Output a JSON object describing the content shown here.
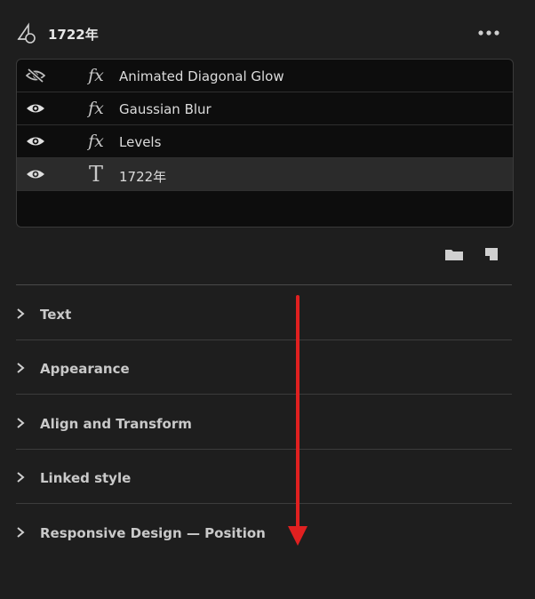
{
  "header": {
    "title": "1722年",
    "more_icon": "ellipsis-icon",
    "layer_icon": "shape-layer-icon"
  },
  "layers": [
    {
      "name": "Animated Diagonal Glow",
      "type_icon": "fx",
      "visible": false
    },
    {
      "name": "Gaussian Blur",
      "type_icon": "fx",
      "visible": true
    },
    {
      "name": "Levels",
      "type_icon": "fx",
      "visible": true
    },
    {
      "name": "1722年",
      "type_icon": "T",
      "visible": true,
      "selected": true
    }
  ],
  "actions": {
    "folder_icon": "folder-icon",
    "new_layer_icon": "new-layer-icon"
  },
  "sections": [
    {
      "label": "Text"
    },
    {
      "label": "Appearance"
    },
    {
      "label": "Align and Transform"
    },
    {
      "label": "Linked style"
    },
    {
      "label": "Responsive Design — Position"
    }
  ],
  "colors": {
    "panel_bg": "#1e1e1e",
    "list_bg": "#0d0d0d",
    "selected_row": "#2b2b2b",
    "annotation_arrow": "#e02020"
  }
}
